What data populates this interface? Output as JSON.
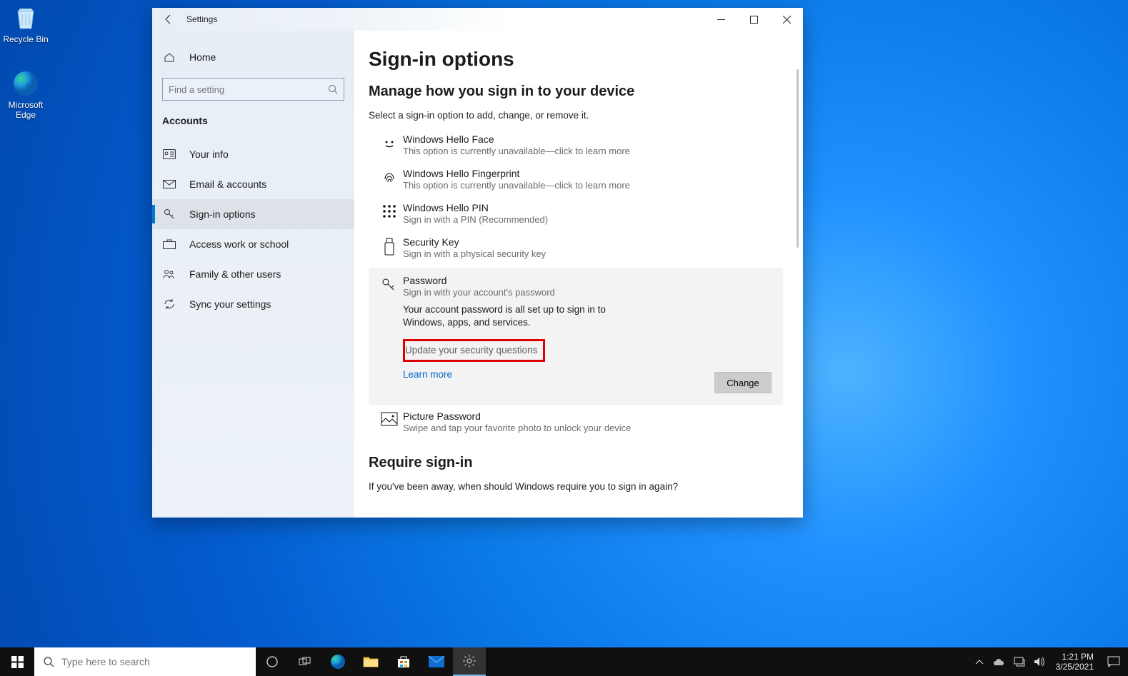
{
  "desktop": {
    "recycle_bin": "Recycle Bin",
    "edge": "Microsoft\nEdge"
  },
  "window": {
    "title": "Settings",
    "home": "Home",
    "search_placeholder": "Find a setting",
    "section": "Accounts",
    "nav": [
      {
        "label": "Your info"
      },
      {
        "label": "Email & accounts"
      },
      {
        "label": "Sign-in options"
      },
      {
        "label": "Access work or school"
      },
      {
        "label": "Family & other users"
      },
      {
        "label": "Sync your settings"
      }
    ]
  },
  "content": {
    "h1": "Sign-in options",
    "h2": "Manage how you sign in to your device",
    "sub": "Select a sign-in option to add, change, or remove it.",
    "options": {
      "face": {
        "title": "Windows Hello Face",
        "sub": "This option is currently unavailable—click to learn more"
      },
      "finger": {
        "title": "Windows Hello Fingerprint",
        "sub": "This option is currently unavailable—click to learn more"
      },
      "pin": {
        "title": "Windows Hello PIN",
        "sub": "Sign in with a PIN (Recommended)"
      },
      "key": {
        "title": "Security Key",
        "sub": "Sign in with a physical security key"
      },
      "password": {
        "title": "Password",
        "sub": "Sign in with your account's password",
        "body": "Your account password is all set up to sign in to Windows, apps, and services.",
        "update": "Update your security questions",
        "learn": "Learn more",
        "change": "Change"
      },
      "picture": {
        "title": "Picture Password",
        "sub": "Swipe and tap your favorite photo to unlock your device"
      }
    },
    "require_h2": "Require sign-in",
    "require_sub": "If you've been away, when should Windows require you to sign in again?"
  },
  "taskbar": {
    "search_placeholder": "Type here to search",
    "time": "1:21 PM",
    "date": "3/25/2021"
  }
}
